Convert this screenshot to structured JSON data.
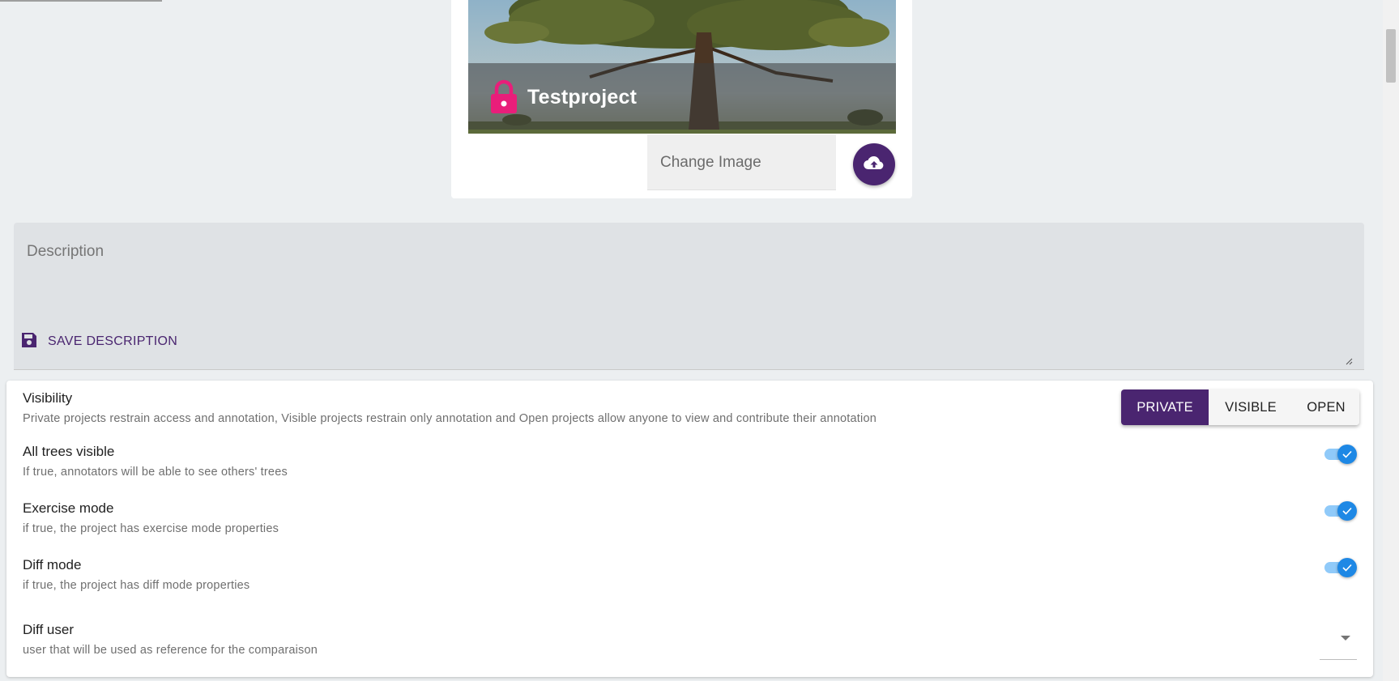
{
  "project": {
    "title": "Testproject",
    "change_image_label": "Change Image"
  },
  "description": {
    "label": "Description",
    "save_label": "SAVE DESCRIPTION"
  },
  "settings": {
    "visibility": {
      "title": "Visibility",
      "description": "Private projects restrain access and annotation, Visible projects restrain only annotation and Open projects allow anyone to view and contribute their annotation",
      "options": [
        "PRIVATE",
        "VISIBLE",
        "OPEN"
      ],
      "selected": "PRIVATE"
    },
    "all_trees_visible": {
      "title": "All trees visible",
      "description": "If true, annotators will be able to see others' trees",
      "enabled": true
    },
    "exercise_mode": {
      "title": "Exercise mode",
      "description": "if true, the project has exercise mode properties",
      "enabled": true
    },
    "diff_mode": {
      "title": "Diff mode",
      "description": "if true, the project has diff mode properties",
      "enabled": true
    },
    "diff_user": {
      "title": "Diff user",
      "description": "user that will be used as reference for the comparaison",
      "value": ""
    }
  },
  "colors": {
    "primary": "#4a2570",
    "lock": "#e91e7a",
    "switch_on": "#1e88e5",
    "background": "#eceff1"
  },
  "icons": {
    "lock": "lock-icon",
    "upload": "cloud-upload-icon",
    "save": "floppy-disk-icon",
    "check": "check-icon",
    "dropdown": "caret-down-icon"
  }
}
